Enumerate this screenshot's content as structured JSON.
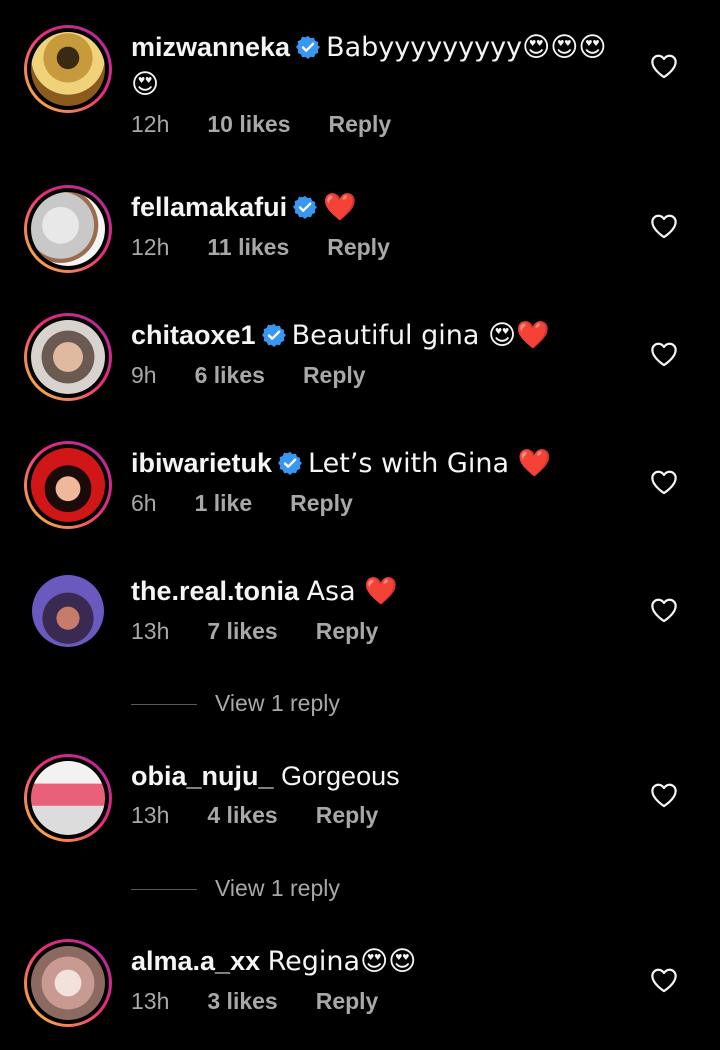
{
  "comments": [
    {
      "username": "mizwanneka",
      "verified": true,
      "text": "Babyyyyyyyyy😍😍😍",
      "text_cont": "😍",
      "time": "12h",
      "likes": "10 likes",
      "reply": "Reply"
    },
    {
      "username": "fellamakafui",
      "verified": true,
      "text": "❤️",
      "time": "12h",
      "likes": "11 likes",
      "reply": "Reply"
    },
    {
      "username": "chitaoxe1",
      "verified": true,
      "text": "Beautiful gina 😍❤️",
      "time": "9h",
      "likes": "6 likes",
      "reply": "Reply"
    },
    {
      "username": "ibiwarietuk",
      "verified": true,
      "text": "Let’s with Gina ❤️",
      "time": "6h",
      "likes": "1 like",
      "reply": "Reply"
    },
    {
      "username": "the.real.tonia",
      "verified": false,
      "text": "Asa ❤️",
      "time": "13h",
      "likes": "7 likes",
      "reply": "Reply",
      "view_replies": "View 1 reply"
    },
    {
      "username": "obia_nuju_",
      "verified": false,
      "text": "Gorgeous",
      "time": "13h",
      "likes": "4 likes",
      "reply": "Reply",
      "view_replies": "View 1 reply"
    },
    {
      "username": "alma.a_xx",
      "verified": false,
      "text": "Regina😍😍",
      "time": "13h",
      "likes": "3 likes",
      "reply": "Reply"
    }
  ],
  "icons": {
    "verified": "verified-badge-icon",
    "like": "heart-outline-icon"
  },
  "colors": {
    "background": "#000000",
    "text": "#f5f5f5",
    "muted": "#a8a8a8",
    "verified": "#3897f0",
    "story_ring_start": "#f9ce34",
    "story_ring_end": "#a62aa6"
  }
}
